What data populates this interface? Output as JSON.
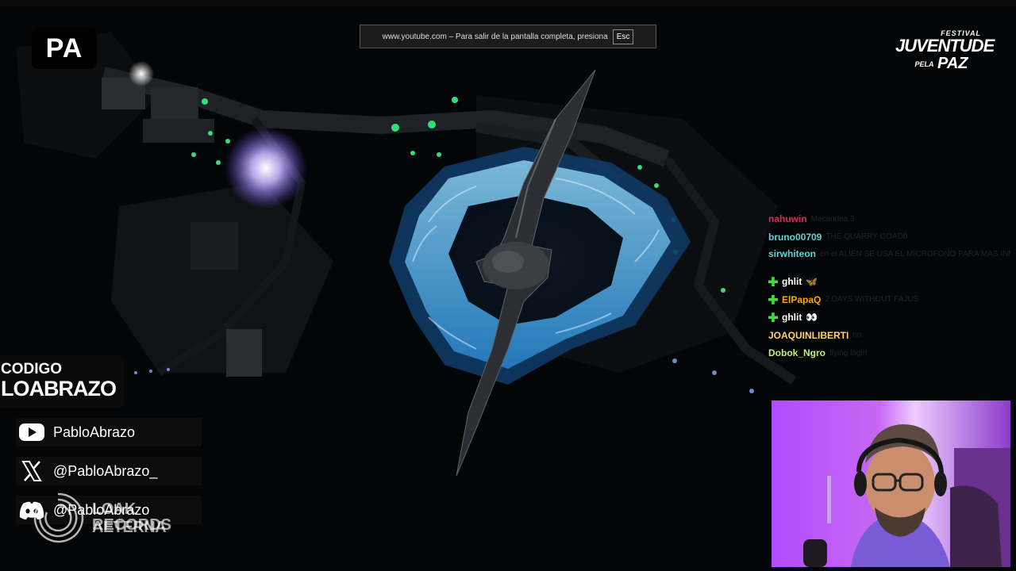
{
  "overlay": {
    "channel_logo": "PA",
    "fullscreen_banner": {
      "text": "www.youtube.com – Para salir de la pantalla completa, presiona",
      "key": "Esc"
    },
    "festival_logo": {
      "top": "FESTIVAL",
      "main": "JUVENTUDE",
      "small": "PELA",
      "bottom": "PAZ"
    },
    "promo_code": {
      "label": "CODIGO",
      "code": "LOABRAZO"
    },
    "socials": [
      {
        "platform": "youtube-icon",
        "handle": "PabloAbrazo"
      },
      {
        "platform": "x-icon",
        "handle": "@PabloAbrazo_"
      },
      {
        "platform": "discord-icon",
        "handle": "@PabloAbrazo"
      }
    ],
    "records_watermark": {
      "line1": "LOAK AETERNA",
      "line2": "RECORDS"
    }
  },
  "chat": {
    "messages": [
      {
        "user": "nahuwin",
        "color": "#e0245e",
        "badge": false,
        "message": "Mecandea 3"
      },
      {
        "user": "bruno00709",
        "color": "#5fd3d8",
        "badge": false,
        "message": "THE QUARRY GOAD0"
      },
      {
        "user": "sirwhiteon",
        "color": "#5fd3d8",
        "badge": false,
        "message": "en el ALIEN SE USA EL MICROFONO PARA MAS INMERSION SI HABLAS EL ALIEN TE PERSIGUE"
      },
      {
        "user": "ghlit",
        "color": "#ffffff",
        "badge": true,
        "emote": "🦋",
        "message": ""
      },
      {
        "user": "ElPapaQ",
        "color": "#ffa500",
        "badge": true,
        "message": "2 DAYS WITHOUT FAJUS"
      },
      {
        "user": "ghlit",
        "color": "#ffffff",
        "badge": true,
        "emote": "👀",
        "message": ""
      },
      {
        "user": "JOAQUINLIBERTI",
        "color": "#ffd36b",
        "badge": false,
        "message": "nn"
      },
      {
        "user": "Dobok_Ngro",
        "color": "#b6f27a",
        "badge": false,
        "message": "flying lagirl"
      }
    ]
  },
  "colors": {
    "stage_blue": "#3fb6ff",
    "accent_green": "#2fe07a",
    "glow_purple": "#a078ff",
    "webcam_wall": "#b04cff"
  }
}
